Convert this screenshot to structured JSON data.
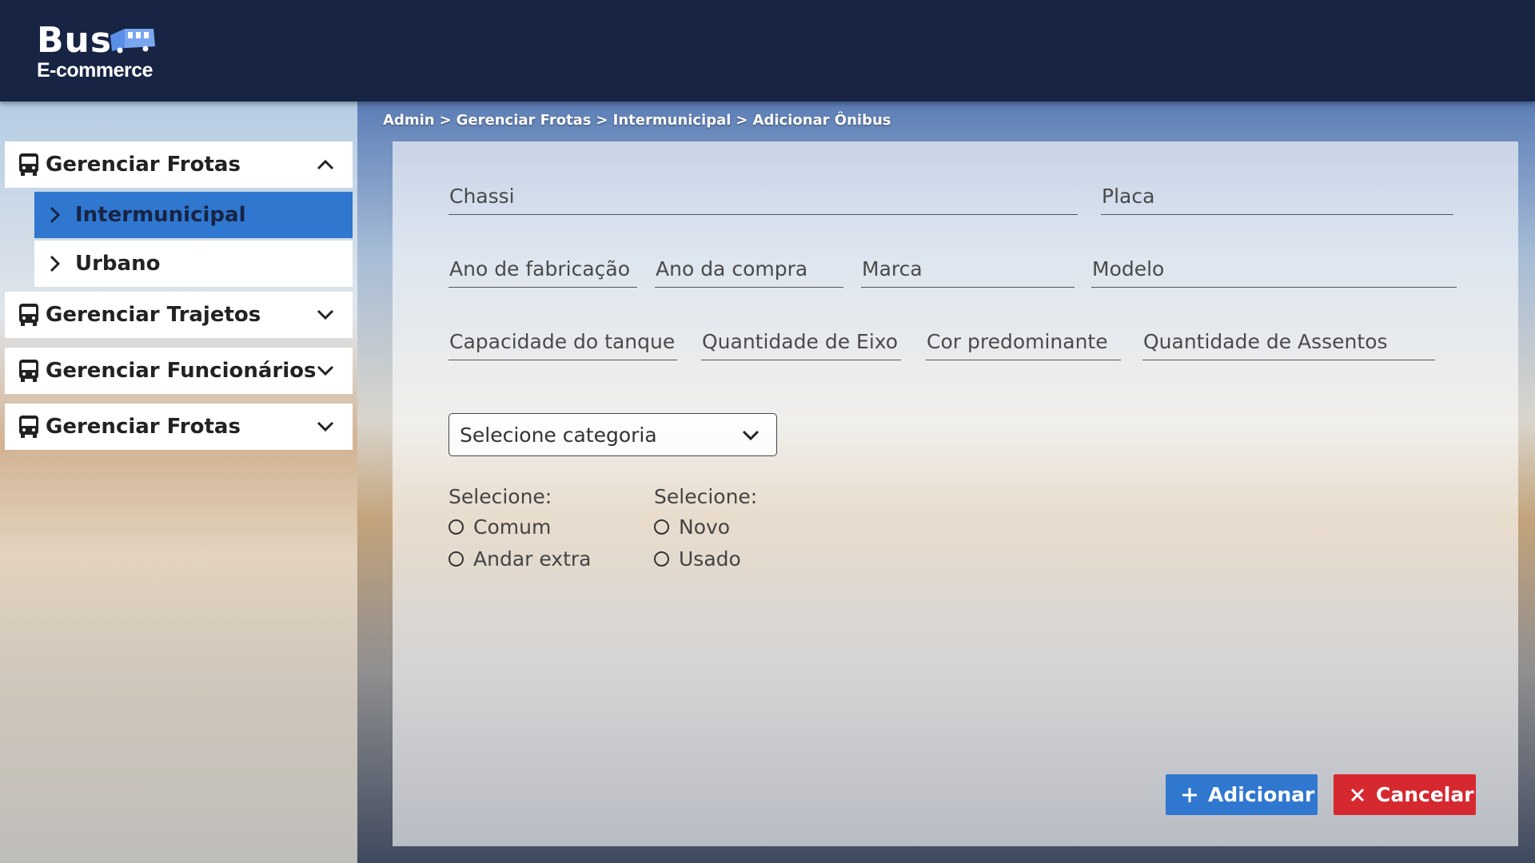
{
  "app": {
    "logo_word": "Bus",
    "logo_sub": "E-commerce"
  },
  "colors": {
    "header_bg": "#172444",
    "accent_blue": "#2f77cf",
    "danger_red": "#d6282f"
  },
  "sidebar": {
    "sections": [
      {
        "label": "Gerenciar Frotas",
        "icon": "bus-icon",
        "expanded": true
      },
      {
        "label": "Gerenciar Trajetos",
        "icon": "bus-icon",
        "expanded": false
      },
      {
        "label": "Gerenciar Funcionários",
        "icon": "bus-icon",
        "expanded": false
      },
      {
        "label": "Gerenciar Frotas",
        "icon": "bus-icon",
        "expanded": false
      }
    ],
    "subitems": [
      {
        "label": "Intermunicipal",
        "active": true
      },
      {
        "label": "Urbano",
        "active": false
      }
    ]
  },
  "breadcrumb": {
    "items": [
      "Admin",
      "Gerenciar Frotas",
      "Intermunicipal",
      "Adicionar Ônibus"
    ],
    "separator": ">"
  },
  "form": {
    "fields": {
      "chassi": "Chassi",
      "placa": "Placa",
      "ano_fabricacao": "Ano de fabricação",
      "ano_compra": "Ano da compra",
      "marca": "Marca",
      "modelo": "Modelo",
      "capacidade_tanque": "Capacidade do tanque",
      "quantidade_eixo": "Quantidade de Eixo",
      "cor_predominante": "Cor predominante",
      "quantidade_assentos": "Quantidade de Assentos"
    },
    "categoria_select": "Selecione categoria",
    "radio_groups": [
      {
        "title": "Selecione:",
        "options": [
          "Comum",
          "Andar extra"
        ]
      },
      {
        "title": "Selecione:",
        "options": [
          "Novo",
          "Usado"
        ]
      }
    ],
    "buttons": {
      "add": "Adicionar",
      "cancel": "Cancelar"
    }
  }
}
